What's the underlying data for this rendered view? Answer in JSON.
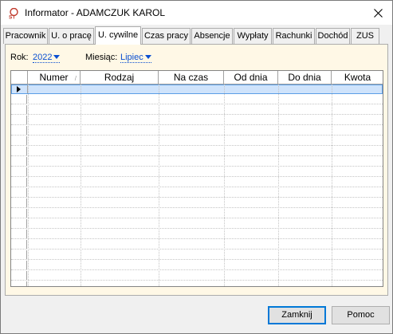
{
  "window": {
    "title": "Informator - ADAMCZUK KAROL",
    "icon": "app-logo-icon",
    "close_icon": "close-icon"
  },
  "tabs": [
    {
      "label": "Pracownik",
      "active": false
    },
    {
      "label": "U. o pracę",
      "active": false
    },
    {
      "label": "U. cywilne",
      "active": true
    },
    {
      "label": "Czas pracy",
      "active": false
    },
    {
      "label": "Absencje",
      "active": false
    },
    {
      "label": "Wypłaty",
      "active": false
    },
    {
      "label": "Rachunki",
      "active": false
    },
    {
      "label": "Dochód",
      "active": false
    },
    {
      "label": "ZUS",
      "active": false
    }
  ],
  "filters": {
    "year_label": "Rok:",
    "year_value": "2022",
    "month_label": "Miesiąc:",
    "month_value": "Lipiec"
  },
  "grid": {
    "columns": [
      "Numer",
      "Rodzaj",
      "Na czas",
      "Od dnia",
      "Do dnia",
      "Kwota"
    ],
    "sorted_column": "Numer",
    "rows": []
  },
  "buttons": {
    "close_label": "Zamknij",
    "help_label": "Pomoc"
  },
  "colors": {
    "panel_background": "#fff8e6",
    "link": "#0a4fd1",
    "selection": "#cfe3fb",
    "default_button_border": "#0078d7"
  }
}
